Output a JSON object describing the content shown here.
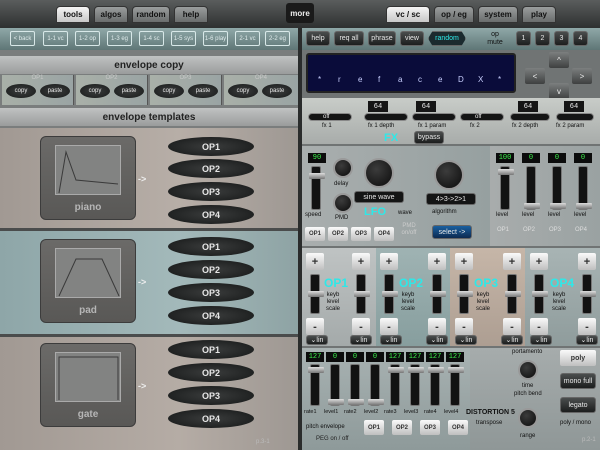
{
  "top_tabs": {
    "tools": "tools",
    "algos": "algos",
    "random": "random",
    "help": "help",
    "more": "more",
    "vc_sc": "vc / sc",
    "op_eg": "op / eg",
    "system": "system",
    "play": "play"
  },
  "nav": [
    "< back",
    "1-1 vc",
    "1-2 op",
    "1-3 eg",
    "1-4 sc",
    "1-5 sys",
    "1-6 play",
    "2-1 vc",
    "2-2 eg"
  ],
  "envelope_copy": {
    "title": "envelope copy",
    "blocks": [
      {
        "label": "OP1",
        "copy": "copy",
        "paste": "paste"
      },
      {
        "label": "OP2",
        "copy": "copy",
        "paste": "paste"
      },
      {
        "label": "OP3",
        "copy": "copy",
        "paste": "paste"
      },
      {
        "label": "OP4",
        "copy": "copy",
        "paste": "paste"
      }
    ]
  },
  "envelope_templates": {
    "title": "envelope templates",
    "templates": [
      {
        "name": "piano",
        "ops": [
          "OP1",
          "OP2",
          "OP3",
          "OP4"
        ],
        "arrow": "->"
      },
      {
        "name": "pad",
        "ops": [
          "OP1",
          "OP2",
          "OP3",
          "OP4"
        ],
        "arrow": "->"
      },
      {
        "name": "gate",
        "ops": [
          "OP1",
          "OP2",
          "OP3",
          "OP4"
        ],
        "arrow": "->"
      }
    ]
  },
  "page_left": "p.3-1",
  "right_toolbar": {
    "help": "help",
    "req_all": "req all",
    "phrase": "phrase",
    "view": "view",
    "random": "random",
    "op_mute": "op\nmute",
    "mute_buttons": [
      "1",
      "2",
      "3",
      "4"
    ]
  },
  "display_text": [
    "*",
    "r",
    "e",
    "f",
    "a",
    "c",
    "e",
    "D",
    "X",
    "*"
  ],
  "arrows": {
    "left": "<",
    "right": ">",
    "up": "^",
    "down": "v"
  },
  "fx": {
    "values": [
      "64",
      "64",
      "64",
      "64"
    ],
    "labels": [
      "fx 1",
      "fx 1 depth",
      "fx 1 param",
      "fx 2",
      "fx 2 depth",
      "fx 2 param"
    ],
    "fx1_state": "off",
    "fx2_state": "off",
    "title": "FX",
    "bypass": "bypass"
  },
  "lfo": {
    "speed_value": "90",
    "speed": "speed",
    "delay": "delay",
    "pmd": "PMD",
    "wave_name": "sine wave",
    "lfo": "LFO",
    "wave": "wave",
    "pmd_toggle": "PMD\non/off",
    "op_buttons": [
      "OP1",
      "OP2",
      "OP3",
      "OP4"
    ]
  },
  "algorithm": {
    "name": "4>3->2>1",
    "label": "algorithm",
    "select": "select ->"
  },
  "levels": {
    "values": [
      "100",
      "0",
      "0",
      "0"
    ],
    "labels": [
      "level",
      "level",
      "level",
      "level"
    ],
    "ops": [
      "OP1",
      "OP2",
      "OP3",
      "OP4"
    ]
  },
  "op_scaling": {
    "ops": [
      "OP1",
      "OP2",
      "OP3",
      "OP4"
    ],
    "key_level": "keyb\nlevel\nscale",
    "plus": "+",
    "minus": "-",
    "curve": "lin",
    "curve_icon": "curve-icon"
  },
  "peg": {
    "values": [
      "127",
      "0",
      "0",
      "0",
      "127",
      "127",
      "127",
      "127"
    ],
    "labels": [
      "rate1",
      "level1",
      "rate2",
      "level2",
      "rate3",
      "level3",
      "rate4",
      "level4"
    ],
    "title": "pitch envelope",
    "toggle_label": "PEG on / off",
    "op_buttons": [
      "OP1",
      "OP2",
      "OP3",
      "OP4"
    ],
    "distortion": "DISTORTION 5",
    "transpose": "transpose"
  },
  "portamento": {
    "label": "portamento",
    "time": "time",
    "range": "range",
    "pitch_bend": "pitch bend",
    "modes": [
      "poly",
      "mono full",
      "legato"
    ],
    "bottom_label": "poly / mono"
  },
  "page_right": "p.2-1",
  "colors": {
    "accent_cyan": "#2ee8e8",
    "display_bg": "#0a0c3a",
    "fader_green": "#3df24d"
  }
}
